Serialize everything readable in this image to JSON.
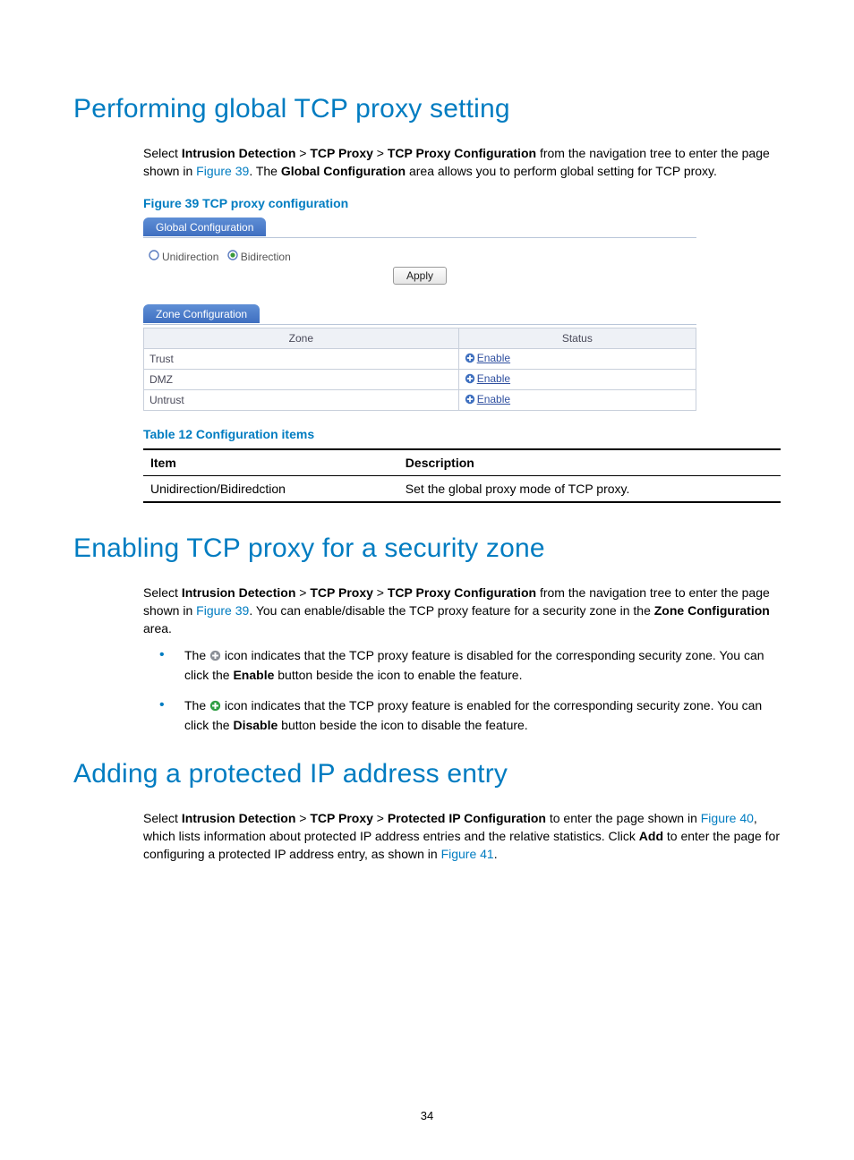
{
  "page_number": "34",
  "sections": {
    "s1": {
      "heading": "Performing global TCP proxy setting",
      "para_pre": "Select ",
      "crumb1": "Intrusion Detection",
      "gt": " > ",
      "crumb2": "TCP Proxy",
      "crumb3": "TCP Proxy Configuration",
      "para_mid1": " from the navigation tree to enter the page shown in ",
      "figref": "Figure 39",
      "para_mid2": ". The ",
      "globconf": "Global Configuration",
      "para_end": " area allows you to perform global setting for TCP proxy."
    },
    "fig39": {
      "caption": "Figure 39 TCP proxy configuration",
      "tab_global": "Global Configuration",
      "radio1": "Unidirection",
      "radio2": "Bidirection",
      "apply": "Apply",
      "tab_zone": "Zone Configuration",
      "th_zone": "Zone",
      "th_status": "Status",
      "rows": [
        {
          "zone": "Trust",
          "action": "Enable"
        },
        {
          "zone": "DMZ",
          "action": "Enable"
        },
        {
          "zone": "Untrust",
          "action": "Enable"
        }
      ]
    },
    "table12": {
      "caption": "Table 12 Configuration items",
      "th_item": "Item",
      "th_desc": "Description",
      "row_item": "Unidirection/Bidiredction",
      "row_desc": "Set the global proxy mode of TCP proxy."
    },
    "s2": {
      "heading": "Enabling TCP proxy for a security zone",
      "para_pre": "Select ",
      "crumb1": "Intrusion Detection",
      "crumb2": "TCP Proxy",
      "crumb3": "TCP Proxy Configuration",
      "para_mid1": " from the navigation tree to enter the page shown in ",
      "figref": "Figure 39",
      "para_mid2": ". You can enable/disable the TCP proxy feature for a security zone in the ",
      "zoneconf": "Zone Configuration",
      "para_end": " area.",
      "b1a": "The ",
      "b1b": " icon indicates that the TCP proxy feature is disabled for the corresponding security zone. You can click the ",
      "b1_enable": "Enable",
      "b1c": " button beside the icon to enable the feature.",
      "b2a": "The ",
      "b2b": " icon indicates that the TCP proxy feature is enabled for the corresponding security zone. You can click the ",
      "b2_disable": "Disable",
      "b2c": " button beside the icon to disable the feature."
    },
    "s3": {
      "heading": "Adding a protected IP address entry",
      "para_pre": "Select ",
      "crumb1": "Intrusion Detection",
      "crumb2": "TCP Proxy",
      "crumb3": "Protected IP Configuration",
      "para_mid1": " to enter the page shown in ",
      "figref40": "Figure 40",
      "para_mid2": ", which lists information about protected IP address entries and the relative statistics. Click ",
      "add": "Add",
      "para_mid3": " to enter the page for configuring a protected IP address entry, as shown in ",
      "figref41": "Figure 41",
      "dot": "."
    }
  }
}
